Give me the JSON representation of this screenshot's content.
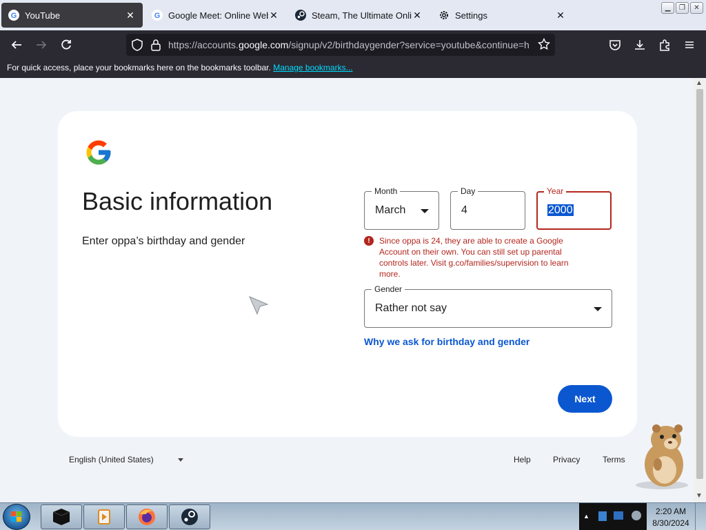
{
  "browser": {
    "tabs": [
      {
        "title": "YouTube",
        "icon": "google-g-icon",
        "active": true
      },
      {
        "title": "Google Meet: Online Web and",
        "icon": "google-g-icon",
        "active": false
      },
      {
        "title": "Steam, The Ultimate Online",
        "icon": "steam-icon",
        "active": false
      },
      {
        "title": "Settings",
        "icon": "gear-icon",
        "active": false
      }
    ],
    "url_prefix": "https://accounts.",
    "url_domain": "google.com",
    "url_suffix": "/signup/v2/birthdaygender?service=youtube&continue=h",
    "bookmarks_text": "For quick access, place your bookmarks here on the bookmarks toolbar.",
    "bookmarks_link": "Manage bookmarks..."
  },
  "form": {
    "heading": "Basic information",
    "subtext": "Enter oppa’s birthday and gender",
    "month_label": "Month",
    "month_value": "March",
    "day_label": "Day",
    "day_value": "4",
    "year_label": "Year",
    "year_value": "2000",
    "error_text": "Since oppa is 24, they are able to create a Google Account on their own. You can still set up parental controls later. Visit g.co/families/supervision to learn more.",
    "gender_label": "Gender",
    "gender_value": "Rather not say",
    "why_link": "Why we ask for birthday and gender",
    "next_label": "Next"
  },
  "footer": {
    "language": "English (United States)",
    "help": "Help",
    "privacy": "Privacy",
    "terms": "Terms"
  },
  "taskbar": {
    "time": "2:20 AM",
    "date": "8/30/2024"
  },
  "colors": {
    "accent": "#0b57d0",
    "error": "#b3261e",
    "chrome_dark": "#2b2a33"
  }
}
